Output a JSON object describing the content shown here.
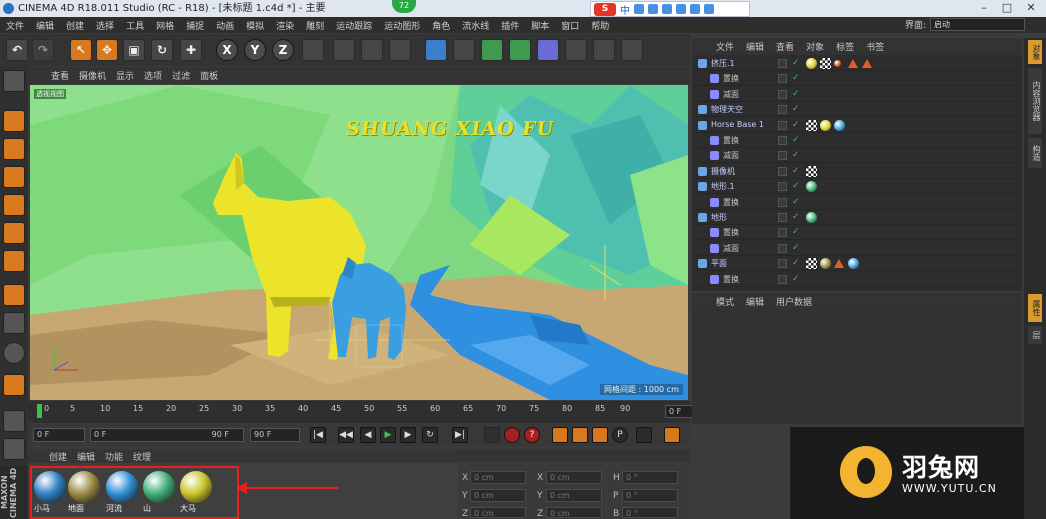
{
  "window": {
    "title": "CINEMA 4D R18.011 Studio (RC - R18) - [未标题 1.c4d *] - 主要",
    "badge": "72",
    "layout_label": "界面:",
    "layout_value": "启动"
  },
  "menu": [
    "文件",
    "编辑",
    "创建",
    "选择",
    "工具",
    "网格",
    "捕捉",
    "动画",
    "模拟",
    "渲染",
    "雕刻",
    "运动跟踪",
    "运动图形",
    "角色",
    "流水线",
    "插件",
    "脚本",
    "窗口",
    "帮助"
  ],
  "ime": {
    "logo": "S",
    "mode": "中"
  },
  "toolbar": {
    "tools": [
      "↶",
      "↷",
      "↖",
      "✥",
      "▣",
      "↻",
      "✚"
    ],
    "axes": [
      "X",
      "Y",
      "Z"
    ]
  },
  "viewport": {
    "menu": [
      "查看",
      "摄像机",
      "显示",
      "选项",
      "过滤",
      "面板"
    ],
    "camera_label": "透视视图",
    "scene_text": "SHUANG XIAO FU",
    "grid_spacing": "网格间距 : 1000 cm"
  },
  "timeline": {
    "ticks": [
      "0",
      "5",
      "10",
      "15",
      "20",
      "25",
      "30",
      "35",
      "40",
      "45",
      "50",
      "55",
      "60",
      "65",
      "70",
      "75",
      "80",
      "85",
      "90"
    ],
    "frame_end_field": "0 F"
  },
  "transport": {
    "start": "0 F",
    "range_start": "0 F",
    "range_end": "90 F",
    "end": "90 F"
  },
  "materials": {
    "menu": [
      "创建",
      "编辑",
      "功能",
      "纹理"
    ],
    "items": [
      {
        "label": "小马",
        "color": "#2e7fc4"
      },
      {
        "label": "地面",
        "color": "#9b8a45"
      },
      {
        "label": "河流",
        "color": "#2f8ed3"
      },
      {
        "label": "山",
        "color": "#3fae78"
      },
      {
        "label": "大马",
        "color": "#c9c42b"
      }
    ]
  },
  "coords": {
    "rows": [
      {
        "a": "X",
        "av": "0 cm",
        "b": "X",
        "bv": "0 cm",
        "c": "H",
        "cv": "0 °"
      },
      {
        "a": "Y",
        "av": "0 cm",
        "b": "Y",
        "bv": "0 cm",
        "c": "P",
        "cv": "0 °"
      },
      {
        "a": "Z",
        "av": "0 cm",
        "b": "Z",
        "bv": "0 cm",
        "c": "B",
        "cv": "0 °"
      }
    ]
  },
  "objects": {
    "menu": [
      "文件",
      "编辑",
      "查看",
      "对象",
      "标签",
      "书签"
    ],
    "rows": [
      {
        "name": "挤压.1",
        "sub": false
      },
      {
        "name": "置换",
        "sub": true
      },
      {
        "name": "减面",
        "sub": true
      },
      {
        "name": "物理天空",
        "sub": false
      },
      {
        "name": "Horse Base 1",
        "sub": false
      },
      {
        "name": "置换",
        "sub": true
      },
      {
        "name": "减面",
        "sub": true
      },
      {
        "name": "摄像机",
        "sub": false
      },
      {
        "name": "地形.1",
        "sub": false
      },
      {
        "name": "置换",
        "sub": true
      },
      {
        "name": "地形",
        "sub": false
      },
      {
        "name": "置换",
        "sub": true
      },
      {
        "name": "减面",
        "sub": true
      },
      {
        "name": "平面",
        "sub": false
      },
      {
        "name": "置换",
        "sub": true
      }
    ]
  },
  "attributes": {
    "menu": [
      "模式",
      "编辑",
      "用户数据"
    ]
  },
  "side_tabs": [
    "对象",
    "内容浏览器",
    "构造",
    "属性",
    "层"
  ],
  "watermark": {
    "cn": "羽兔网",
    "en": "WWW.YUTU.CN"
  },
  "brand": "MAXON CINEMA 4D"
}
